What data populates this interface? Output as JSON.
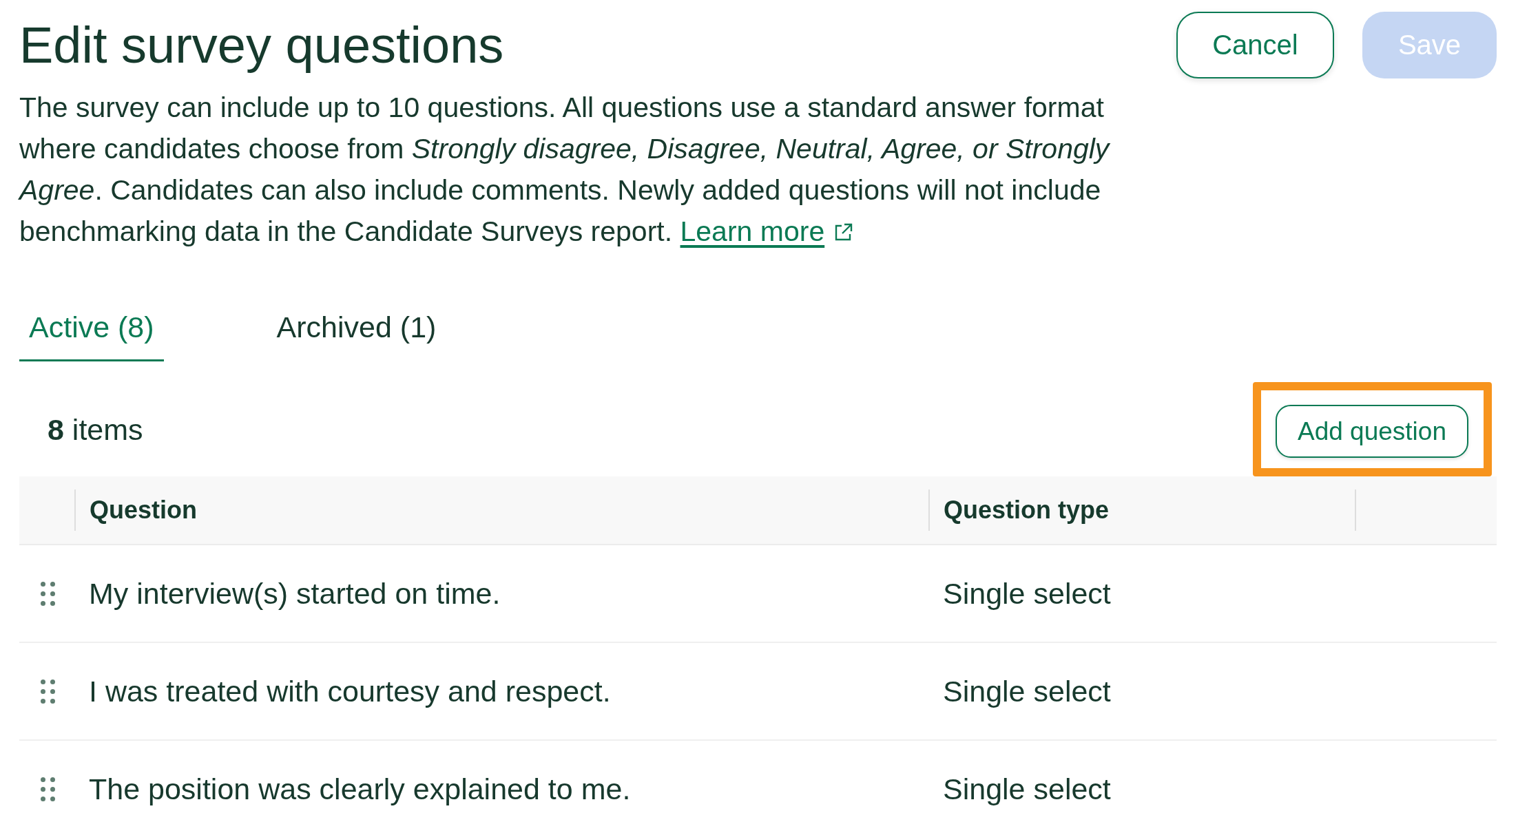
{
  "page": {
    "title": "Edit survey questions",
    "description": "The survey can include up to 10 questions. All questions use a standard answer format where candidates choose from *Strongly disagree, Disagree, Neutral, Agree, or Strongly Agree*. Candidates can also include comments. Newly added questions will not include benchmarking data in the Candidate Surveys report.",
    "learn_more_link": "Learn more"
  },
  "actions": [
    {
      "label": "Cancel",
      "kind": "secondary",
      "disabled": false
    },
    {
      "label": "Save",
      "kind": "primary",
      "disabled": true
    }
  ],
  "tabs": [
    {
      "label": "Active (8)",
      "selected": true
    },
    {
      "label": "Archived (1)",
      "selected": false
    }
  ],
  "toolbar": {
    "item_count": "**8** items",
    "add_button": {
      "label": "Add question",
      "highlighted": true
    }
  },
  "table": {
    "columns": [
      "Question",
      "Question type"
    ],
    "rows": [
      {
        "question": "My interview(s) started on time.",
        "type": "Single select"
      },
      {
        "question": "I was treated with courtesy and respect.",
        "type": "Single select"
      },
      {
        "question": "The position was clearly explained to me.",
        "type": "Single select"
      }
    ]
  }
}
